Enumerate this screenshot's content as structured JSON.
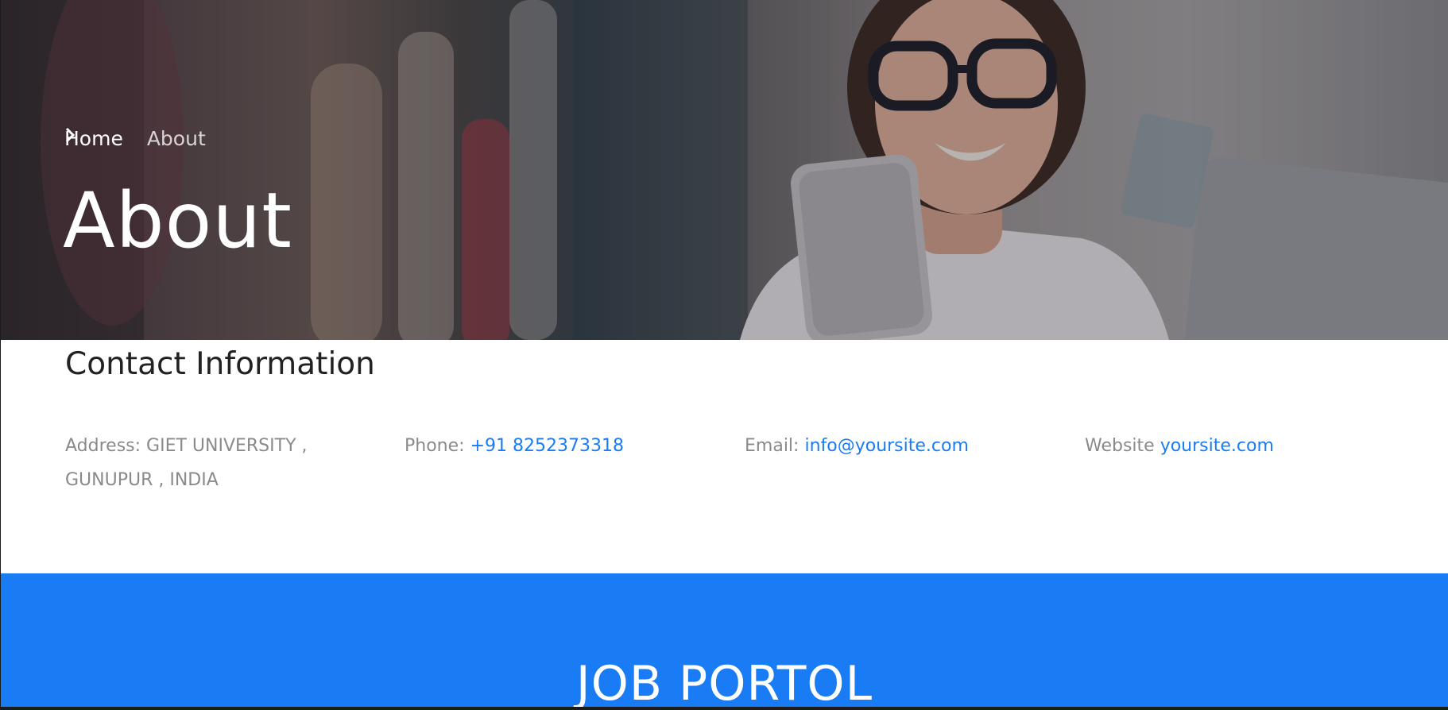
{
  "hero": {
    "breadcrumb": {
      "home_label": "Home",
      "current_label": "About"
    },
    "title": "About"
  },
  "contact": {
    "title": "Contact Information",
    "address": {
      "label": "Address:",
      "value": "GIET UNIVERSITY , GUNUPUR , INDIA"
    },
    "phone": {
      "label": "Phone:",
      "value": "+91 8252373318"
    },
    "email": {
      "label": "Email:",
      "value": "info@yoursite.com"
    },
    "website": {
      "label": "Website",
      "value": "yoursite.com"
    }
  },
  "footer": {
    "title": "JOB PORTOL"
  },
  "colors": {
    "accent": "#1a7cf5",
    "muted_text": "#8a8a8a",
    "heading_text": "#222222"
  },
  "icons": {
    "breadcrumb_separator": "chevron-right-icon"
  }
}
